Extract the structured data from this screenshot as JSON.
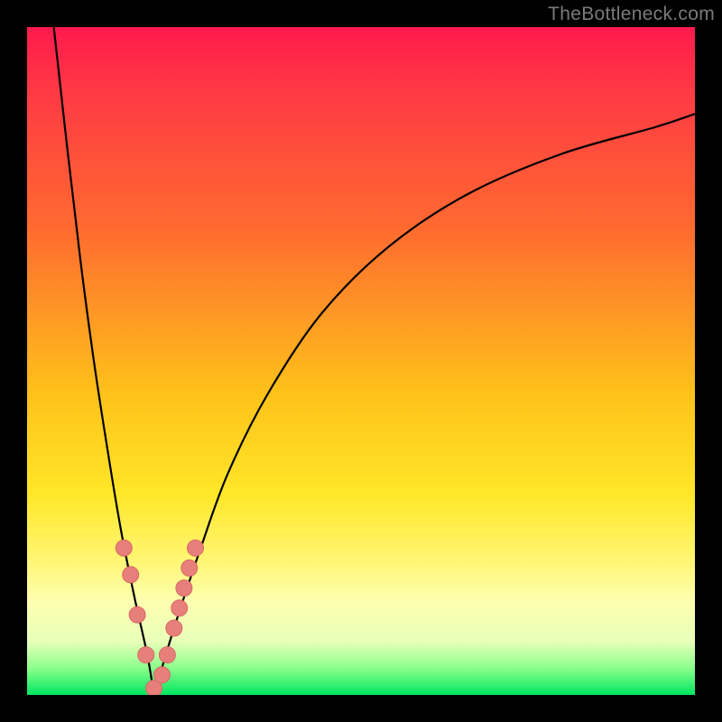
{
  "watermark": "TheBottleneck.com",
  "colors": {
    "frame": "#000000",
    "watermark_text": "#7a7a7a",
    "curve": "#000000",
    "marker_fill": "#e77f7a",
    "marker_stroke": "#d86a65",
    "gradient_stops": [
      "#ff1a4d",
      "#ff3a44",
      "#ff6a30",
      "#ffc21a",
      "#ffe728",
      "#fff675",
      "#fdffb0",
      "#e8ffb8",
      "#8bff8b",
      "#00e660"
    ]
  },
  "chart_data": {
    "type": "line",
    "title": "",
    "xlabel": "",
    "ylabel": "",
    "xlim": [
      0,
      100
    ],
    "ylim": [
      0,
      100
    ],
    "notes": "V-shaped bottleneck curve. Left branch descends steeply from top-left; right branch rises with diminishing slope toward top-right. Minimum (zero bottleneck) near x≈19. Background hue encodes severity: green=good (low y), red=bad (high y). Values are read off the plot proportionally; no axis ticks are shown.",
    "series": [
      {
        "name": "bottleneck-curve-left",
        "x": [
          4,
          6,
          8,
          10,
          12,
          14,
          16,
          18,
          19
        ],
        "values": [
          100,
          82,
          65,
          50,
          37,
          25,
          15,
          6,
          0
        ]
      },
      {
        "name": "bottleneck-curve-right",
        "x": [
          19,
          22,
          26,
          30,
          36,
          44,
          54,
          66,
          80,
          94,
          100
        ],
        "values": [
          0,
          10,
          22,
          33,
          45,
          57,
          67,
          75,
          81,
          85,
          87
        ]
      }
    ],
    "markers": {
      "name": "sample-points",
      "x": [
        14.5,
        15.5,
        16.5,
        17.8,
        19.0,
        20.2,
        21.0,
        22.0,
        22.8,
        23.5,
        24.3,
        25.2
      ],
      "values": [
        22,
        18,
        12,
        6,
        1,
        3,
        6,
        10,
        13,
        16,
        19,
        22
      ]
    }
  }
}
